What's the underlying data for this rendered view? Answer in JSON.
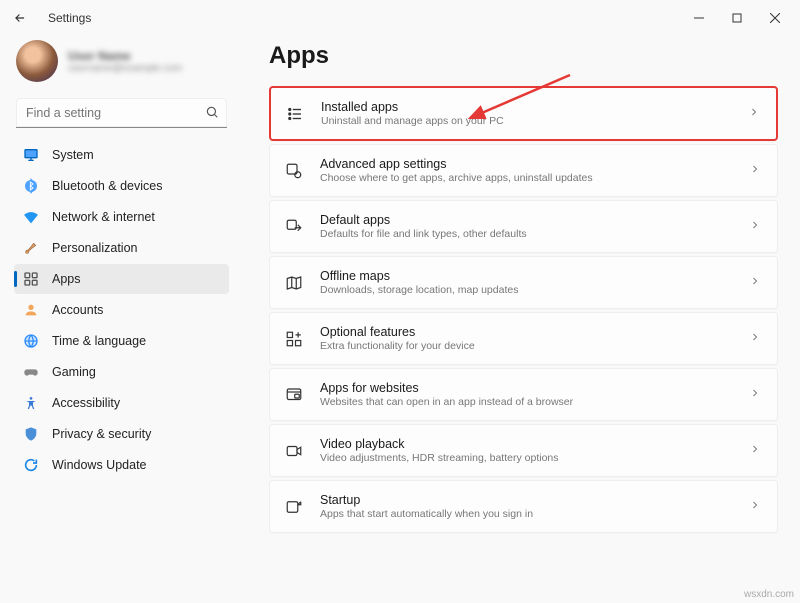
{
  "window": {
    "title": "Settings"
  },
  "profile": {
    "name": "User Name",
    "email": "username@example.com"
  },
  "search": {
    "placeholder": "Find a setting"
  },
  "sidebar": {
    "items": [
      {
        "label": "System"
      },
      {
        "label": "Bluetooth & devices"
      },
      {
        "label": "Network & internet"
      },
      {
        "label": "Personalization"
      },
      {
        "label": "Apps"
      },
      {
        "label": "Accounts"
      },
      {
        "label": "Time & language"
      },
      {
        "label": "Gaming"
      },
      {
        "label": "Accessibility"
      },
      {
        "label": "Privacy & security"
      },
      {
        "label": "Windows Update"
      }
    ]
  },
  "page": {
    "title": "Apps"
  },
  "cards": [
    {
      "title": "Installed apps",
      "sub": "Uninstall and manage apps on your PC"
    },
    {
      "title": "Advanced app settings",
      "sub": "Choose where to get apps, archive apps, uninstall updates"
    },
    {
      "title": "Default apps",
      "sub": "Defaults for file and link types, other defaults"
    },
    {
      "title": "Offline maps",
      "sub": "Downloads, storage location, map updates"
    },
    {
      "title": "Optional features",
      "sub": "Extra functionality for your device"
    },
    {
      "title": "Apps for websites",
      "sub": "Websites that can open in an app instead of a browser"
    },
    {
      "title": "Video playback",
      "sub": "Video adjustments, HDR streaming, battery options"
    },
    {
      "title": "Startup",
      "sub": "Apps that start automatically when you sign in"
    }
  ],
  "watermark": "wsxdn.com"
}
